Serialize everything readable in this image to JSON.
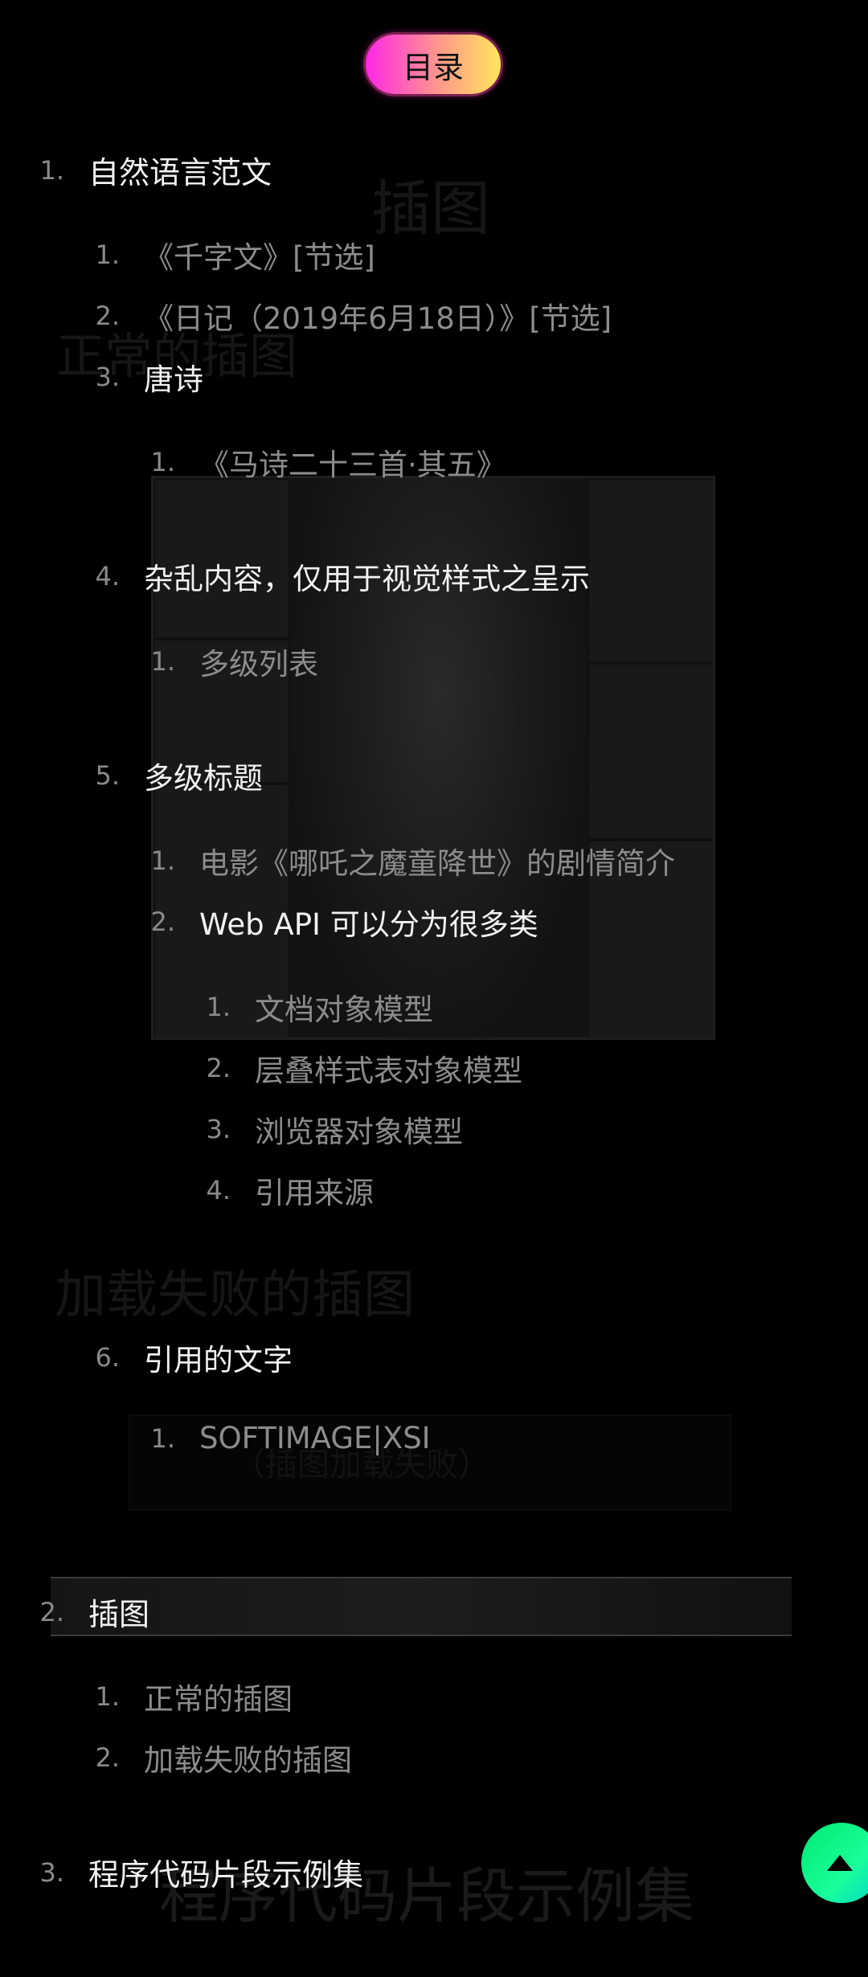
{
  "toc_button": {
    "label": "目录"
  },
  "toc": {
    "s1": {
      "num": "1.",
      "label": "自然语言范文"
    },
    "s1_1": {
      "num": "1.",
      "label": "《千字文》[节选]"
    },
    "s1_2": {
      "num": "2.",
      "label": "《日记（2019年6月18日）》[节选]"
    },
    "s1_3": {
      "num": "3.",
      "label": "唐诗"
    },
    "s1_3_1": {
      "num": "1.",
      "label": "《马诗二十三首·其五》"
    },
    "s1_4": {
      "num": "4.",
      "label": "杂乱内容，仅用于视觉样式之呈示"
    },
    "s1_4_1": {
      "num": "1.",
      "label": "多级列表"
    },
    "s1_5": {
      "num": "5.",
      "label": "多级标题"
    },
    "s1_5_1": {
      "num": "1.",
      "label": "电影《哪吒之魔童降世》的剧情简介"
    },
    "s1_5_2": {
      "num": "2.",
      "label": "Web API 可以分为很多类"
    },
    "s1_5_2_1": {
      "num": "1.",
      "label": "文档对象模型"
    },
    "s1_5_2_2": {
      "num": "2.",
      "label": "层叠样式表对象模型"
    },
    "s1_5_2_3": {
      "num": "3.",
      "label": "浏览器对象模型"
    },
    "s1_5_2_4": {
      "num": "4.",
      "label": "引用来源"
    },
    "s1_6": {
      "num": "6.",
      "label": "引用的文字"
    },
    "s1_6_1": {
      "num": "1.",
      "label": "SOFTIMAGE|XSI"
    },
    "s2": {
      "num": "2.",
      "label": "插图"
    },
    "s2_1": {
      "num": "1.",
      "label": "正常的插图"
    },
    "s2_2": {
      "num": "2.",
      "label": "加载失败的插图"
    },
    "s3": {
      "num": "3.",
      "label": "程序代码片段示例集"
    }
  },
  "background_ghost": {
    "heading_illustrations": "插图",
    "heading_normal_illustration": "正常的插图",
    "heading_failed_illustration": "加载失败的插图",
    "failed_image_alt": "（插图加载失败）",
    "heading_code_snippets": "程序代码片段示例集"
  },
  "back_to_top": {
    "icon": "arrow-up-icon"
  },
  "colors": {
    "toc_button_gradient": [
      "#ff27e6",
      "#ff9a8a",
      "#ffe55a"
    ],
    "back_to_top_gradient": [
      "#00e870",
      "#19ff9b",
      "#00d6c8"
    ],
    "background": "#000000"
  }
}
